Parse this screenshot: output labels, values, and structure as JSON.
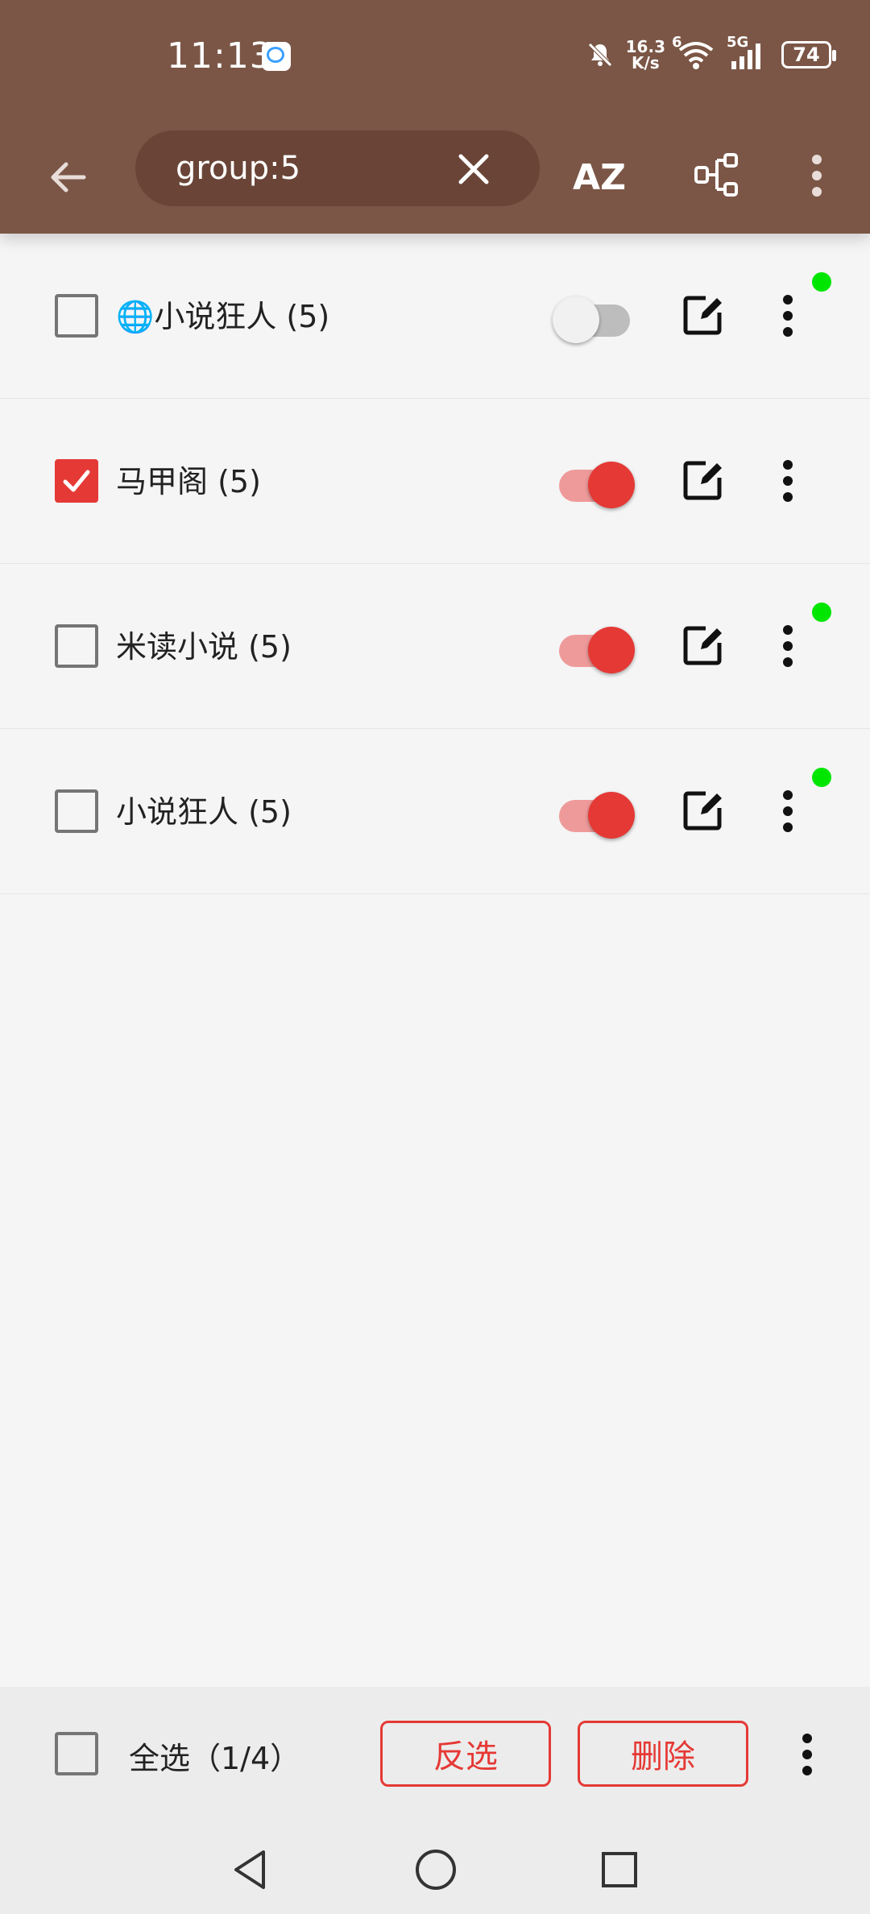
{
  "status_bar": {
    "time": "11:13",
    "net_speed_value": "16.3",
    "net_speed_unit": "K/s",
    "wifi_label": "6",
    "network": "5G",
    "battery": "74"
  },
  "toolbar": {
    "search_value": "group:5",
    "sort_label": "AZ"
  },
  "sources": [
    {
      "title": "🌐小说狂人 (5)",
      "checked": false,
      "enabled": false,
      "indicator": true
    },
    {
      "title": "马甲阁 (5)",
      "checked": true,
      "enabled": true,
      "indicator": false
    },
    {
      "title": "米读小说 (5)",
      "checked": false,
      "enabled": true,
      "indicator": true
    },
    {
      "title": "小说狂人 (5)",
      "checked": false,
      "enabled": true,
      "indicator": true
    }
  ],
  "bottom_bar": {
    "select_all_label": "全选（1/4）",
    "invert_label": "反选",
    "delete_label": "删除"
  },
  "colors": {
    "appbar": "#7b5646",
    "accent": "#e53935",
    "indicator": "#00e600"
  }
}
